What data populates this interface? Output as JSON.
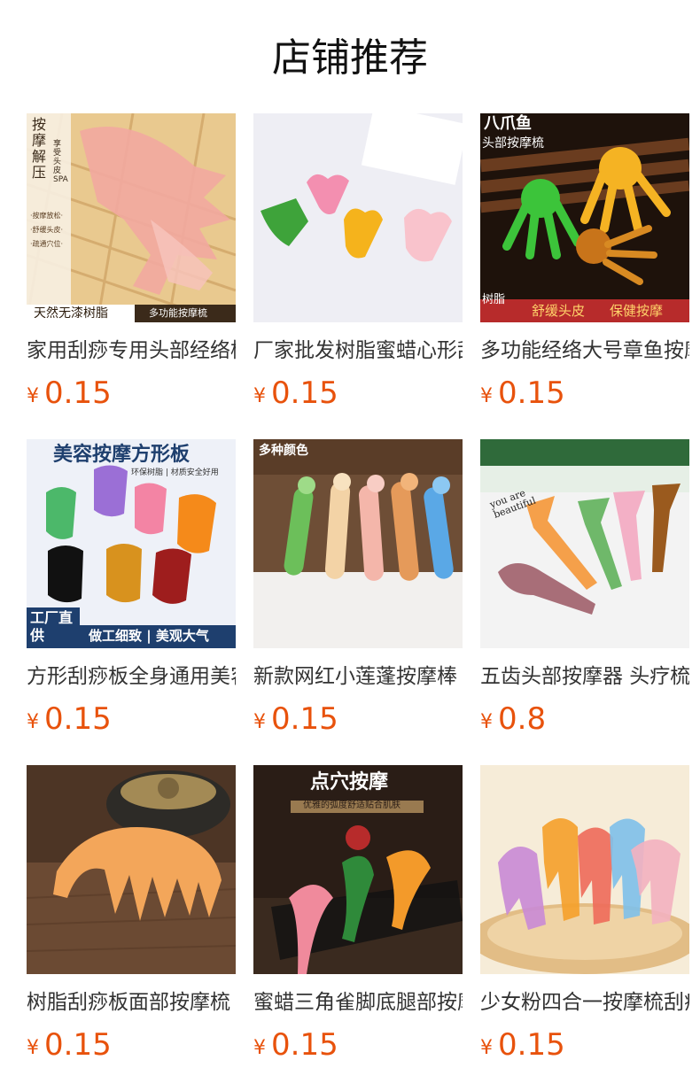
{
  "section": {
    "title": "店铺推荐"
  },
  "currency_symbol": "¥",
  "products": [
    {
      "name": "家用刮痧专用头部经络梳",
      "price": "0.15",
      "image_text": [
        "按摩解压",
        "享受头皮SPA",
        "·按摩放松·",
        "·舒缓头皮·",
        "·疏通穴位·",
        "天然无漆树脂",
        "多功能按摩梳"
      ],
      "colors": {
        "bg": "#e9c98f",
        "item": "#f2a9a0"
      }
    },
    {
      "name": "厂家批发树脂蜜蜡心形刮痧板",
      "price": "0.15",
      "image_text": [],
      "colors": {
        "bg": "#eeeef4",
        "item": "#f6b9c8"
      }
    },
    {
      "name": "多功能经络大号章鱼按摩梳",
      "price": "0.15",
      "image_text": [
        "八爪鱼",
        "头部按摩梳",
        "树脂",
        "舒缓头皮",
        "保健按摩"
      ],
      "colors": {
        "bg": "#2b1a12",
        "item": "#f5b323"
      }
    },
    {
      "name": "方形刮痧板全身通用美容板",
      "price": "0.15",
      "image_text": [
        "美容按摩方形板",
        "环保树脂 | 材质安全好用",
        "工厂直供",
        "做工细致 | 美观大气"
      ],
      "colors": {
        "bg": "#eef1f8",
        "item": "#9b6fd6"
      }
    },
    {
      "name": "新款网红小莲蓬按摩棒",
      "price": "0.15",
      "image_text": [
        "多种颜色"
      ],
      "colors": {
        "bg": "#6e4e36",
        "item": "#f0c39a"
      }
    },
    {
      "name": "五齿头部按摩器 头疗梳",
      "price": "0.8",
      "image_text": [
        "you are beautiful"
      ],
      "colors": {
        "bg": "#f3f3f3",
        "item": "#f5a04a"
      }
    },
    {
      "name": "树脂刮痧板面部按摩梳",
      "price": "0.15",
      "image_text": [],
      "colors": {
        "bg": "#6b4a33",
        "item": "#f3a65a"
      }
    },
    {
      "name": "蜜蜡三角雀脚底腿部按摩器",
      "price": "0.15",
      "image_text": [
        "点穴按摩",
        "优雅的弧度舒适贴合肌肤"
      ],
      "colors": {
        "bg": "#2a1d16",
        "item": "#f08a9c"
      }
    },
    {
      "name": "少女粉四合一按摩梳刮痧板",
      "price": "0.15",
      "image_text": [],
      "colors": {
        "bg": "#f6ecd8",
        "item": "#f3b1c0"
      }
    }
  ]
}
